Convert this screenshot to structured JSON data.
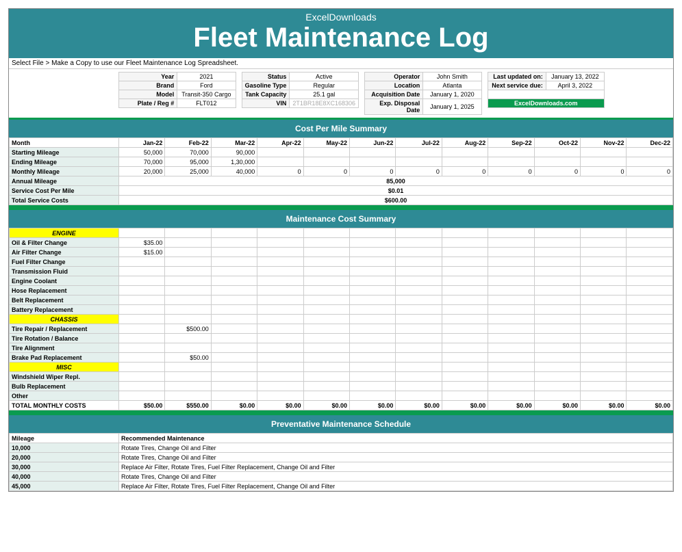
{
  "header": {
    "sub": "ExcelDownloads",
    "title": "Fleet Maintenance Log"
  },
  "instruction": "Select File > Make a Copy to use our Fleet Maintenance Log Spreadsheet.",
  "info": {
    "vehicle": [
      {
        "k": "Year",
        "v": "2021"
      },
      {
        "k": "Brand",
        "v": "Ford"
      },
      {
        "k": "Model",
        "v": "Transit-350 Cargo"
      },
      {
        "k": "Plate / Reg #",
        "v": "FLT012"
      }
    ],
    "spec": [
      {
        "k": "Status",
        "v": "Active"
      },
      {
        "k": "Gasoline Type",
        "v": "Regular"
      },
      {
        "k": "Tank Capacity",
        "v": "25.1 gal"
      },
      {
        "k": "VIN",
        "v": "2T1BR18E8XC168306"
      }
    ],
    "ownership": [
      {
        "k": "Operator",
        "v": "John Smith"
      },
      {
        "k": "Location",
        "v": "Atlanta"
      },
      {
        "k": "Acquisition Date",
        "v": "January 1, 2020"
      },
      {
        "k": "Exp. Disposal Date",
        "v": "January 1, 2025"
      }
    ],
    "service": [
      {
        "k": "Last updated on:",
        "v": "January 13, 2022"
      },
      {
        "k": "Next service due:",
        "v": "April 3, 2022"
      }
    ],
    "link": "ExcelDownloads.com"
  },
  "sections": {
    "cost_per_mile": "Cost Per Mile Summary",
    "maintenance_cost": "Maintenance Cost Summary",
    "preventative": "Preventative Maintenance Schedule"
  },
  "months": [
    "Jan-22",
    "Feb-22",
    "Mar-22",
    "Apr-22",
    "May-22",
    "Jun-22",
    "Jul-22",
    "Aug-22",
    "Sep-22",
    "Oct-22",
    "Nov-22",
    "Dec-22"
  ],
  "cost_rows": {
    "month_label": "Month",
    "start": {
      "label": "Starting Mileage",
      "vals": [
        "50,000",
        "70,000",
        "90,000",
        "",
        "",
        "",
        "",
        "",
        "",
        "",
        "",
        ""
      ]
    },
    "end": {
      "label": "Ending Mileage",
      "vals": [
        "70,000",
        "95,000",
        "1,30,000",
        "",
        "",
        "",
        "",
        "",
        "",
        "",
        "",
        ""
      ]
    },
    "monthly": {
      "label": "Monthly Mileage",
      "vals": [
        "20,000",
        "25,000",
        "40,000",
        "0",
        "0",
        "0",
        "0",
        "0",
        "0",
        "0",
        "0",
        "0"
      ]
    },
    "annual": {
      "label": "Annual Mileage",
      "val": "85,000"
    },
    "scpm": {
      "label": "Service Cost Per Mile",
      "val": "$0.01"
    },
    "total": {
      "label": "Total Service Costs",
      "val": "$600.00"
    }
  },
  "maint": {
    "cat_engine": "ENGINE",
    "oil": {
      "label": "Oil & Filter Change",
      "vals": [
        "$35.00",
        "",
        "",
        "",
        "",
        "",
        "",
        "",
        "",
        "",
        "",
        ""
      ]
    },
    "air": {
      "label": "Air Filter Change",
      "vals": [
        "$15.00",
        "",
        "",
        "",
        "",
        "",
        "",
        "",
        "",
        "",
        "",
        ""
      ]
    },
    "fuel": {
      "label": "Fuel Filter Change",
      "vals": [
        "",
        "",
        "",
        "",
        "",
        "",
        "",
        "",
        "",
        "",
        "",
        ""
      ]
    },
    "trans": {
      "label": "Transmission Fluid",
      "vals": [
        "",
        "",
        "",
        "",
        "",
        "",
        "",
        "",
        "",
        "",
        "",
        ""
      ]
    },
    "coolant": {
      "label": "Engine Coolant",
      "vals": [
        "",
        "",
        "",
        "",
        "",
        "",
        "",
        "",
        "",
        "",
        "",
        ""
      ]
    },
    "hose": {
      "label": "Hose Replacement",
      "vals": [
        "",
        "",
        "",
        "",
        "",
        "",
        "",
        "",
        "",
        "",
        "",
        ""
      ]
    },
    "belt": {
      "label": "Belt Replacement",
      "vals": [
        "",
        "",
        "",
        "",
        "",
        "",
        "",
        "",
        "",
        "",
        "",
        ""
      ]
    },
    "battery": {
      "label": "Battery Replacement",
      "vals": [
        "",
        "",
        "",
        "",
        "",
        "",
        "",
        "",
        "",
        "",
        "",
        ""
      ]
    },
    "cat_chassis": "CHASSIS",
    "tire_repair": {
      "label": "Tire Repair / Replacement",
      "vals": [
        "",
        "$500.00",
        "",
        "",
        "",
        "",
        "",
        "",
        "",
        "",
        "",
        ""
      ]
    },
    "tire_rot": {
      "label": "Tire Rotation / Balance",
      "vals": [
        "",
        "",
        "",
        "",
        "",
        "",
        "",
        "",
        "",
        "",
        "",
        ""
      ]
    },
    "tire_align": {
      "label": "Tire Alignment",
      "vals": [
        "",
        "",
        "",
        "",
        "",
        "",
        "",
        "",
        "",
        "",
        "",
        ""
      ]
    },
    "brake": {
      "label": "Brake Pad Replacement",
      "vals": [
        "",
        "$50.00",
        "",
        "",
        "",
        "",
        "",
        "",
        "",
        "",
        "",
        ""
      ]
    },
    "cat_misc": "MISC",
    "wiper": {
      "label": "Windshield Wiper Repl.",
      "vals": [
        "",
        "",
        "",
        "",
        "",
        "",
        "",
        "",
        "",
        "",
        "",
        ""
      ]
    },
    "bulb": {
      "label": "Bulb Replacement",
      "vals": [
        "",
        "",
        "",
        "",
        "",
        "",
        "",
        "",
        "",
        "",
        "",
        ""
      ]
    },
    "other": {
      "label": "Other",
      "vals": [
        "",
        "",
        "",
        "",
        "",
        "",
        "",
        "",
        "",
        "",
        "",
        ""
      ]
    },
    "total": {
      "label": "TOTAL MONTHLY COSTS",
      "vals": [
        "$50.00",
        "$550.00",
        "$0.00",
        "$0.00",
        "$0.00",
        "$0.00",
        "$0.00",
        "$0.00",
        "$0.00",
        "$0.00",
        "$0.00",
        "$0.00"
      ]
    }
  },
  "pm": {
    "hdr": {
      "mileage": "Mileage",
      "rec": "Recommended Maintenance"
    },
    "rows": [
      {
        "m": "10,000",
        "r": "Rotate Tires, Change Oil and Filter"
      },
      {
        "m": "20,000",
        "r": "Rotate Tires, Change Oil and Filter"
      },
      {
        "m": "30,000",
        "r": "Replace Air Filter, Rotate Tires, Fuel Filter Replacement, Change Oil and Filter"
      },
      {
        "m": "40,000",
        "r": "Rotate Tires, Change Oil and Filter"
      },
      {
        "m": "45,000",
        "r": "Replace Air Filter, Rotate Tires, Fuel Filter Replacement, Change Oil and Filter"
      }
    ]
  }
}
